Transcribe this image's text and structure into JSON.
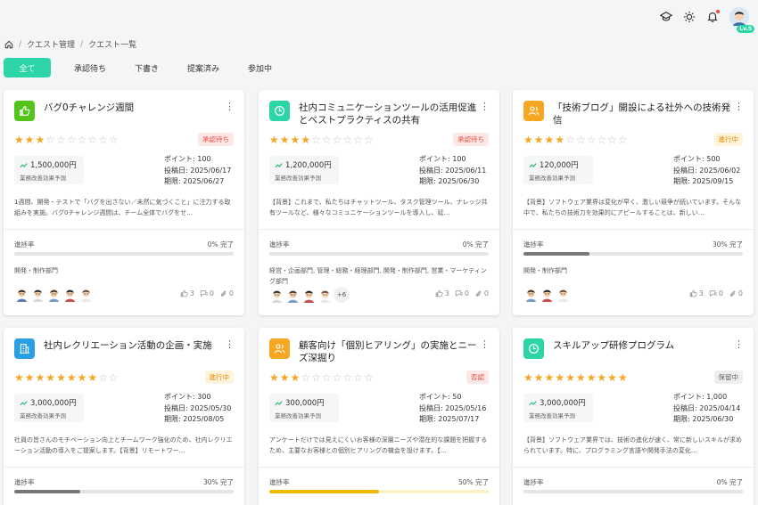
{
  "header": {
    "level_badge": "Lv.5"
  },
  "breadcrumb": {
    "items": [
      "クエスト管理",
      "クエスト一覧"
    ],
    "sep": "/"
  },
  "tabs": [
    {
      "label": "全て",
      "active": true
    },
    {
      "label": "承認待ち",
      "active": false
    },
    {
      "label": "下書き",
      "active": false
    },
    {
      "label": "提案済み",
      "active": false
    },
    {
      "label": "参加中",
      "active": false
    }
  ],
  "colors": {
    "accent": "#2dd4a8",
    "star": "#f5a623",
    "green_icon": "#52c41a",
    "teal_icon": "#2dd4a8",
    "orange_icon": "#f5a623",
    "blue_icon": "#29a0e6"
  },
  "labels": {
    "money_sub": "業務改善効果予測",
    "progress": "進捗率",
    "point_prefix": "ポイント: ",
    "posted_prefix": "投稿日: ",
    "deadline_prefix": "期限: "
  },
  "cards": [
    {
      "title": "バグ0チャレンジ週間",
      "icon": "thumbs-up-icon",
      "icon_color": "#52c41a",
      "stars": 3,
      "status": "承認待ち",
      "status_color": "#e74c3c",
      "status_bg": "#fde8e8",
      "money": "1,500,000円",
      "point": "100",
      "posted": "2025/06/17",
      "deadline": "2025/06/27",
      "description": "1週間、開発・テストで「バグを出さない／未然に気づくこと」に注力する取組みを実施。バグ0チャレンジ週間は、チーム全体でバグをせ…",
      "progress_text": "0% 完了",
      "progress": 0,
      "progress_color": "#777777",
      "dept": "開発・制作部門",
      "avatar_count": 5,
      "more": "",
      "likes": "3",
      "comments": "0",
      "attachments": "0"
    },
    {
      "title": "社内コミュニケーションツールの活用促進とベストプラクティスの共有",
      "icon": "clock-icon",
      "icon_color": "#2dd4a8",
      "stars": 4,
      "status": "承認待ち",
      "status_color": "#e74c3c",
      "status_bg": "#fde8e8",
      "money": "1,200,000円",
      "point": "100",
      "posted": "2025/06/11",
      "deadline": "2025/06/30",
      "description": "【背景】これまで、私たちはチャットツール、タスク管理ツール、ナレッジ共有ツールなど、様々なコミュニケーションツールを導入し、延…",
      "progress_text": "0% 完了",
      "progress": 0,
      "progress_color": "#777777",
      "dept": "経営・企画部門, 管理・総務・経理部門, 開発・制作部門, 営業・マーケティング部門",
      "avatar_count": 4,
      "more": "+6",
      "likes": "3",
      "comments": "0",
      "attachments": "0"
    },
    {
      "title": "「技術ブログ」開設による社外への技術発信",
      "icon": "users-icon",
      "icon_color": "#f5a623",
      "stars": 4,
      "status": "進行中",
      "status_color": "#e08a00",
      "status_bg": "#fff3dc",
      "money": "120,000円",
      "point": "500",
      "posted": "2025/06/02",
      "deadline": "2025/09/15",
      "description": "【背景】ソフトウェア業界は変化が早く、激しい競争が続いています。そんな中で、私たちの技術力を効果的にアピールすることは、新しい…",
      "progress_text": "30% 完了",
      "progress": 0.3,
      "progress_color": "#777777",
      "dept": "開発・制作部門",
      "avatar_count": 3,
      "more": "",
      "likes": "3",
      "comments": "0",
      "attachments": "0"
    },
    {
      "title": "社内レクリエーション活動の企画・実施",
      "icon": "building-icon",
      "icon_color": "#29a0e6",
      "stars": 8,
      "status": "進行中",
      "status_color": "#e08a00",
      "status_bg": "#fff3dc",
      "money": "3,000,000円",
      "point": "300",
      "posted": "2025/05/30",
      "deadline": "2025/08/05",
      "description": "社員の皆さんのモチベーション向上とチームワーク強化のため、社内レクリエーション活動の導入をご提案します。【背景】リモートワー…",
      "progress_text": "30% 完了",
      "progress": 0.3,
      "progress_color": "#777777",
      "dept": "",
      "avatar_count": 0,
      "more": "",
      "likes": "",
      "comments": "",
      "attachments": ""
    },
    {
      "title": "顧客向け「個別ヒアリング」の実施とニーズ深掘り",
      "icon": "users-icon",
      "icon_color": "#f5a623",
      "stars": 3,
      "status": "否認",
      "status_color": "#e74c3c",
      "status_bg": "#fde8e8",
      "money": "300,000円",
      "point": "50",
      "posted": "2025/05/16",
      "deadline": "2025/07/17",
      "description": "アンケートだけでは見えにくいお客様の深層ニーズや潜在的な課題を把握するため、主要なお客様との個別ヒアリングの機会を設けます。【…",
      "progress_text": "50% 完了",
      "progress": 0.5,
      "progress_color": "#f5b800",
      "dept": "",
      "avatar_count": 0,
      "more": "",
      "likes": "",
      "comments": "",
      "attachments": ""
    },
    {
      "title": "スキルアップ研修プログラム",
      "icon": "clock-icon",
      "icon_color": "#2dd4a8",
      "stars": 10,
      "status": "保留中",
      "status_color": "#666666",
      "status_bg": "#eeeeee",
      "money": "3,000,000円",
      "point": "1,000",
      "posted": "2025/04/14",
      "deadline": "2025/06/30",
      "description": "【背景】ソフトウェア業界では、技術の進化が速く、常に新しいスキルが求められています。特に、プログラミング言語や開発手法の変化…",
      "progress_text": "0% 完了",
      "progress": 0,
      "progress_color": "#777777",
      "dept": "",
      "avatar_count": 0,
      "more": "",
      "likes": "",
      "comments": "",
      "attachments": ""
    }
  ]
}
